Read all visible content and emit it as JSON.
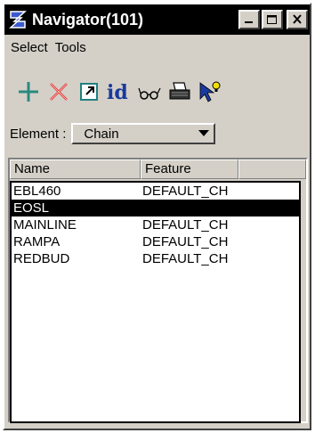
{
  "window": {
    "title": "Navigator(101)"
  },
  "menu": {
    "items": [
      "Select",
      "Tools"
    ]
  },
  "toolbar": {
    "tools": [
      {
        "icon": "plus-icon",
        "color": "#2a8a80"
      },
      {
        "icon": "delete-x-icon",
        "color": "#e03030"
      },
      {
        "icon": "window-arrow-icon"
      },
      {
        "icon": "id-icon",
        "label": "id",
        "color": "#1a3a9a"
      },
      {
        "icon": "glasses-icon"
      },
      {
        "icon": "printer-icon"
      },
      {
        "icon": "pointer-bulb-icon",
        "color": "#1a3aa0"
      }
    ]
  },
  "element": {
    "label": "Element :",
    "value": "Chain"
  },
  "list": {
    "columns": [
      "Name",
      "Feature"
    ],
    "rows": [
      {
        "name": "EBL460",
        "feature": "DEFAULT_CH",
        "selected": false
      },
      {
        "name": "EOSL",
        "feature": "",
        "selected": true
      },
      {
        "name": "MAINLINE",
        "feature": "DEFAULT_CH",
        "selected": false
      },
      {
        "name": "RAMPA",
        "feature": "DEFAULT_CH",
        "selected": false
      },
      {
        "name": "REDBUD",
        "feature": "DEFAULT_CH",
        "selected": false
      }
    ]
  }
}
